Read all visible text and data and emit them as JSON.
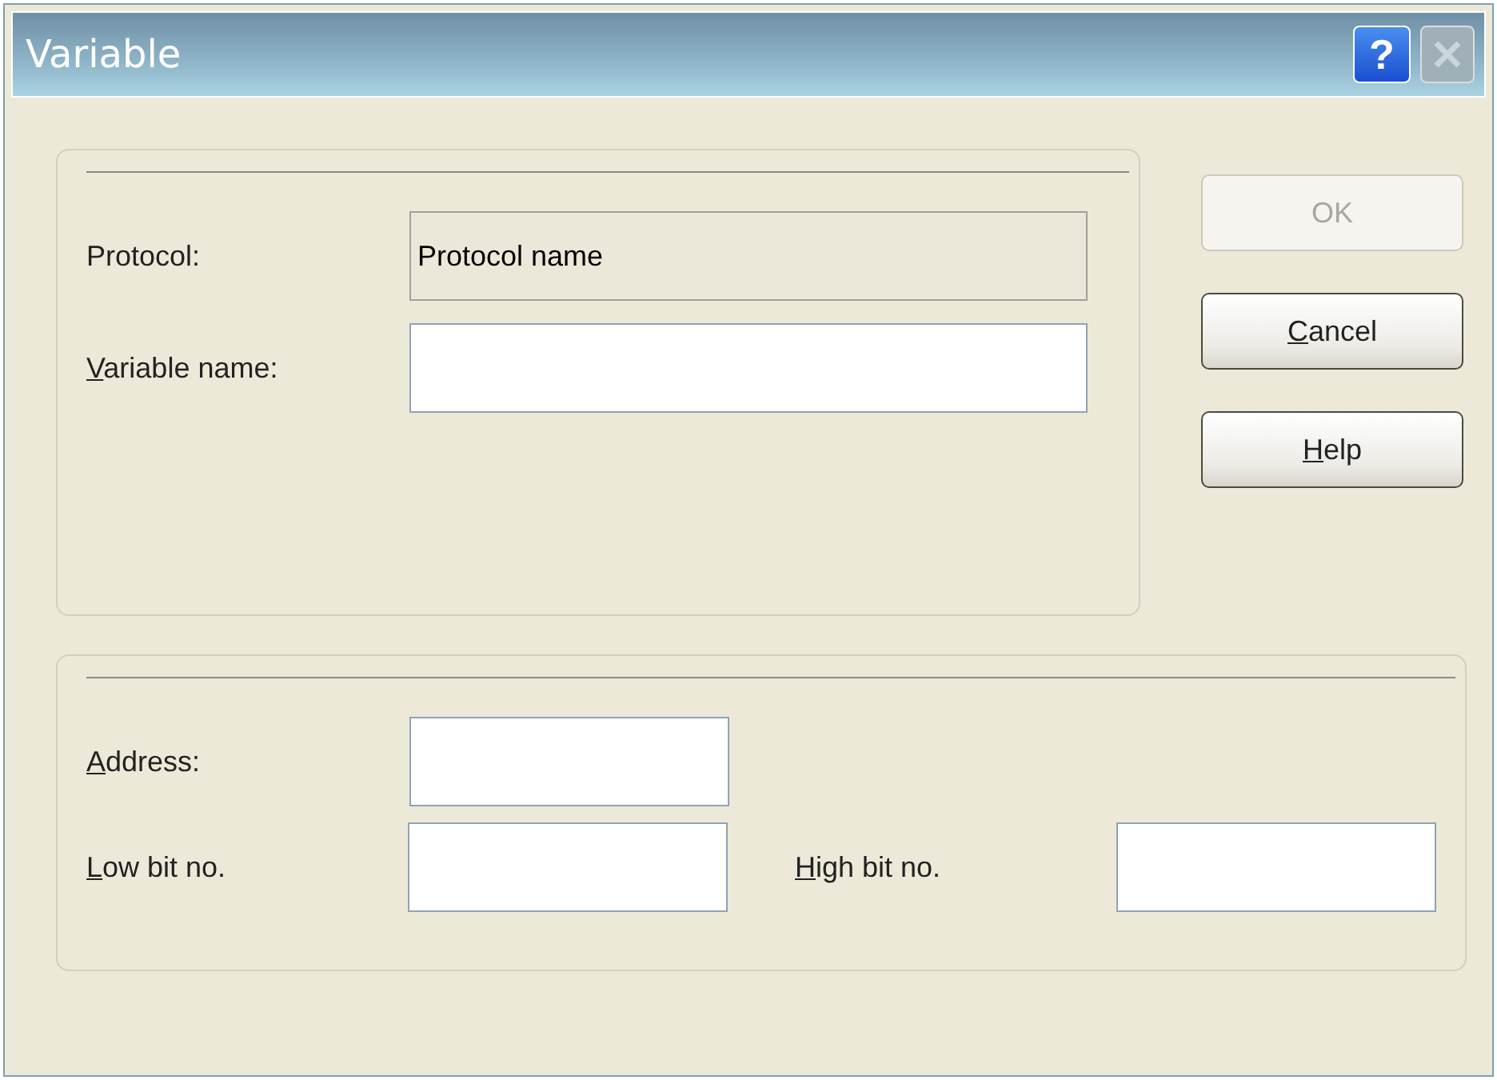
{
  "window": {
    "title": "Variable",
    "help_button": {
      "label": "?"
    },
    "close_button": {
      "disabled": true
    }
  },
  "group_1": {
    "fields": [
      {
        "label": "Protocol:",
        "underline_first": false,
        "value": "Protocol name",
        "readonly": true
      },
      {
        "label": "Variable name:",
        "underline_first": true,
        "readonly": false
      }
    ]
  },
  "buttons": [
    {
      "label": "OK",
      "underline_first": false,
      "disabled": true
    },
    {
      "label": "Cancel",
      "underline_first": true,
      "disabled": false
    },
    {
      "label": "Help",
      "underline_first": true,
      "disabled": false
    }
  ],
  "group_2": {
    "fields": [
      {
        "label": "Address:",
        "underline_first": true
      },
      {
        "label": "Low bit no.",
        "underline_first": true
      },
      {
        "label": "High bit no.",
        "underline_first": true
      }
    ]
  }
}
